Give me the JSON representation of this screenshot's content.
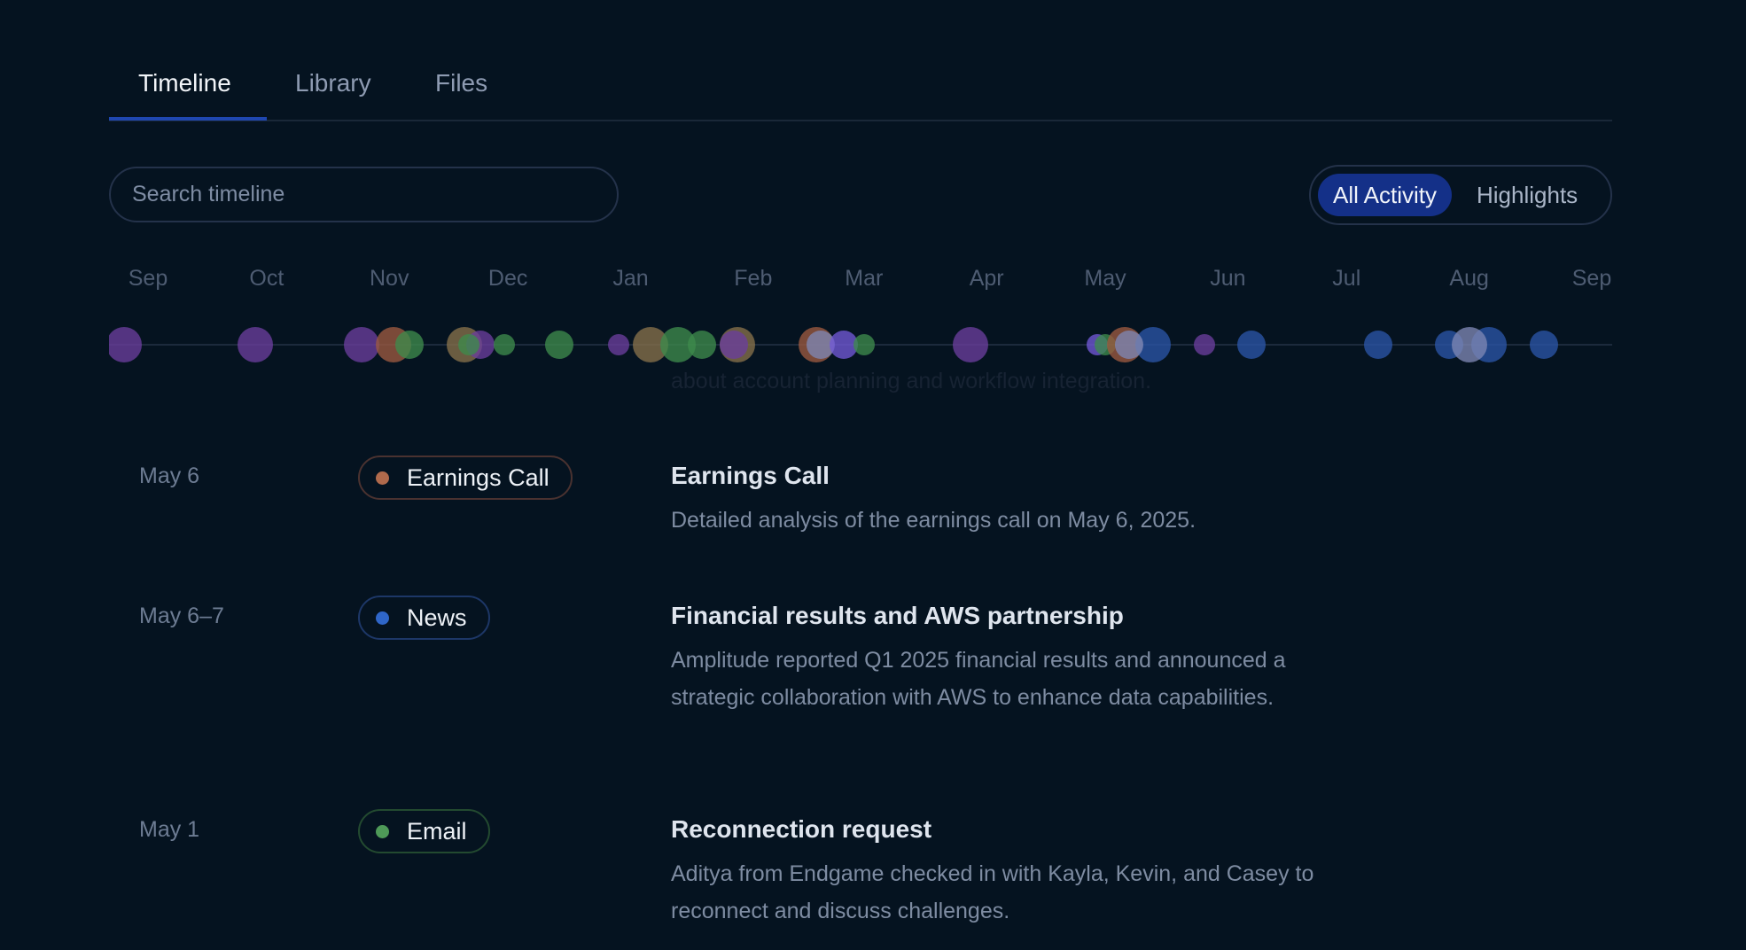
{
  "tabs": [
    {
      "label": "Timeline",
      "active": true
    },
    {
      "label": "Library",
      "active": false
    },
    {
      "label": "Files",
      "active": false
    }
  ],
  "search": {
    "placeholder": "Search timeline",
    "value": ""
  },
  "filter_toggle": {
    "options": [
      "All Activity",
      "Highlights"
    ],
    "selected": "All Activity"
  },
  "colors": {
    "accent": "#1f47b0",
    "purple": "#6a3e9c",
    "orange": "#9c5a40",
    "green": "#3e8a4b",
    "gold": "#87714a",
    "blue": "#2a55a6",
    "violet": "#7159d6",
    "light": "#7d86b4"
  },
  "timeline": {
    "months": [
      "Sep",
      "Oct",
      "Nov",
      "Dec",
      "Jan",
      "Feb",
      "Mar",
      "Apr",
      "May",
      "Jun",
      "Jul",
      "Aug",
      "Sep"
    ],
    "range": [
      "2024-09-01",
      "2025-09-01"
    ],
    "events": [
      {
        "date": "2024-08-26",
        "color": "purple",
        "size": "large"
      },
      {
        "date": "2024-09-28",
        "color": "purple",
        "size": "large"
      },
      {
        "date": "2024-10-25",
        "color": "purple",
        "size": "large"
      },
      {
        "date": "2024-11-02",
        "color": "orange",
        "size": "large"
      },
      {
        "date": "2024-11-06",
        "color": "green",
        "size": "medium"
      },
      {
        "date": "2024-11-20",
        "color": "gold",
        "size": "large"
      },
      {
        "date": "2024-11-24",
        "color": "purple",
        "size": "medium"
      },
      {
        "date": "2024-11-21",
        "color": "green",
        "size": "small"
      },
      {
        "date": "2024-11-30",
        "color": "green",
        "size": "small"
      },
      {
        "date": "2024-12-14",
        "color": "green",
        "size": "medium"
      },
      {
        "date": "2024-12-29",
        "color": "purple",
        "size": "small"
      },
      {
        "date": "2025-01-06",
        "color": "gold",
        "size": "large"
      },
      {
        "date": "2025-01-13",
        "color": "green",
        "size": "large"
      },
      {
        "date": "2025-01-19",
        "color": "green",
        "size": "medium"
      },
      {
        "date": "2025-01-28",
        "color": "gold",
        "size": "large"
      },
      {
        "date": "2025-01-27",
        "color": "purple",
        "size": "medium"
      },
      {
        "date": "2025-02-17",
        "color": "orange",
        "size": "large"
      },
      {
        "date": "2025-02-18",
        "color": "light",
        "size": "medium"
      },
      {
        "date": "2025-02-24",
        "color": "violet",
        "size": "medium"
      },
      {
        "date": "2025-03-01",
        "color": "green",
        "size": "small"
      },
      {
        "date": "2025-03-28",
        "color": "purple",
        "size": "large"
      },
      {
        "date": "2025-04-29",
        "color": "violet",
        "size": "small"
      },
      {
        "date": "2025-05-01",
        "color": "green",
        "size": "small"
      },
      {
        "date": "2025-05-06",
        "color": "orange",
        "size": "large"
      },
      {
        "date": "2025-05-13",
        "color": "blue",
        "size": "large"
      },
      {
        "date": "2025-05-07",
        "color": "light",
        "size": "medium"
      },
      {
        "date": "2025-05-26",
        "color": "purple",
        "size": "small"
      },
      {
        "date": "2025-06-07",
        "color": "blue",
        "size": "medium"
      },
      {
        "date": "2025-07-09",
        "color": "blue",
        "size": "medium"
      },
      {
        "date": "2025-07-27",
        "color": "blue",
        "size": "medium"
      },
      {
        "date": "2025-08-06",
        "color": "blue",
        "size": "large"
      },
      {
        "date": "2025-08-01",
        "color": "light",
        "size": "large"
      },
      {
        "date": "2025-08-20",
        "color": "blue",
        "size": "medium"
      }
    ]
  },
  "background_text": "about account planning and workflow integration.",
  "entries": [
    {
      "date": "May 6",
      "type": "Earnings Call",
      "color": "#b06a4c",
      "border": "#4a3230",
      "title": "Earnings Call",
      "description": "Detailed analysis of the earnings call on May 6, 2025."
    },
    {
      "date": "May 6–7",
      "type": "News",
      "color": "#2f66c8",
      "border": "#1d3767",
      "title": "Financial results and AWS partnership",
      "description": "Amplitude reported Q1 2025 financial results and announced a strategic collaboration with AWS to enhance data capabilities."
    },
    {
      "date": "May 1",
      "type": "Email",
      "color": "#4e9a58",
      "border": "#234a30",
      "title": "Reconnection request",
      "description": "Aditya from Endgame checked in with Kayla, Kevin, and Casey to reconnect and discuss challenges."
    }
  ]
}
